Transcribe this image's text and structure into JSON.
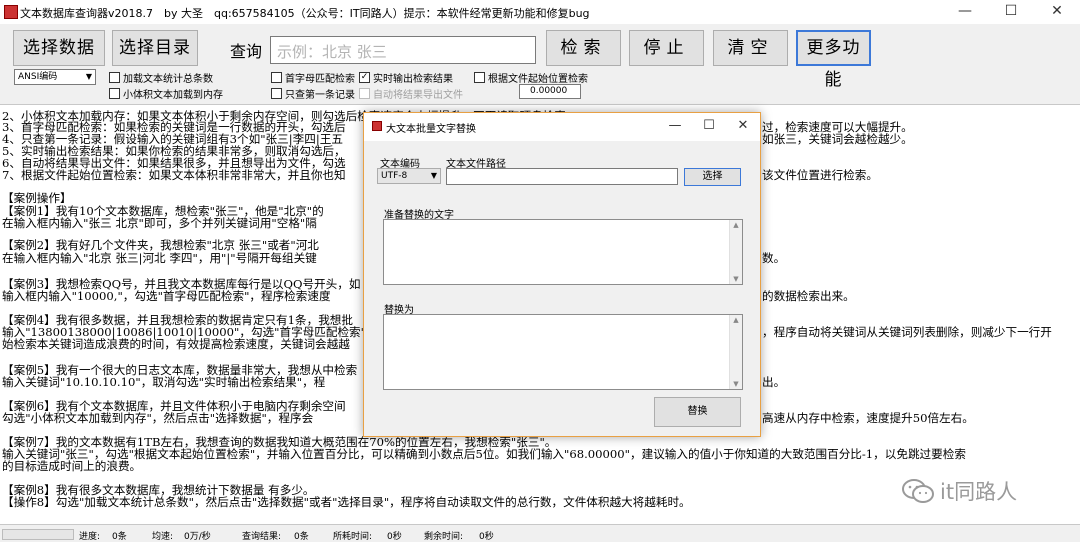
{
  "window": {
    "title": "文本数据库查询器v2018.7　by 大圣　qq:657584105（公众号：IT同路人）提示：本软件经常更新功能和修复bug",
    "minimize": "—",
    "maximize": "☐",
    "close": "✕"
  },
  "toolbar": {
    "select_data": "选择数据",
    "select_dir": "选择目录",
    "query_label": "查询",
    "search_placeholder": "示例：北京 张三",
    "search_btn": "检索",
    "stop_btn": "停止",
    "clear_btn": "清空",
    "more_btn": "更多功能"
  },
  "options": {
    "encoding": "ANSI编码",
    "load_count": "加载文本统计总条数",
    "small_load_memory": "小体积文本加载到内存",
    "prefix_match": "首字母匹配检索",
    "only_first": "只查第一条记录",
    "realtime_output": "实时输出检索结果",
    "auto_export": "自动将结果导出文件",
    "by_position": "根据文件起始位置检索",
    "position_value": "0.00000",
    "realtime_output_checked": true
  },
  "content_lines": [
    "2、小体积文本加载内存：如果文本体积小于剩余内存空间，则勾选后检索速度会大幅提升，不再读取硬盘检索。",
    "3、首字母匹配检索：如果检索的关键词是一行数据的开头，勾选后",
    "4、只查第一条记录：假设输入的关键词组有3个如\"张三|李四|王五",
    "5、实时输出检索结果：如果你检索的结果非常多，则取消勾选后，",
    "6、自动将结果导出文件：如果结果很多，并且想导出为文件，勾选",
    "7、根据文件起始位置检索：如果文本体积非常非常大，并且你也知",
    "",
    "【案例操作】",
    "【案例1】我有10个文本数据库，想检索\"张三\"，他是\"北京\"的",
    "在输入框内输入\"张三 北京\"即可，多个并列关键词用\"空格\"隔",
    "",
    "【案例2】我有好几个文件夹，我想检索\"北京 张三\"或者\"河北",
    "在输入框内输入\"北京 张三|河北 李四\"，用\"|\"号隔开每组关键",
    "",
    "【案例3】我想检索QQ号，并且我文本数据库每行是以QQ号开头，如",
    "输入框内输入\"10000,\"，勾选\"首字母匹配检索\"，程序检索速度",
    "",
    "【案例4】我有很多数据，并且我想检索的数据肯定只有1条，我想批",
    "输入\"13800138000|10086|10010|10000\"，勾选\"首字母匹配检索\"",
    "始检索本关键词造成浪费的时间，有效提高检索速度，关键词会越越",
    "",
    "【案例5】我有一个很大的日志文本库，数据量非常大，我想从中检索",
    "输入关键词\"10.10.10.10\"，取消勾选\"实时输出检索结果\"，程",
    "",
    "【案例6】我有个文本数据库，并且文件体积小于电脑内存剩余空间",
    "勾选\"小体积文本加载到内存\"，然后点击\"选择数据\"，程序会",
    "",
    "【案例7】我的文本数据有1TB左右，我想查询的数据我知道大概范围在70%的位置左右，我想检索\"张三\"。",
    "输入关键词\"张三\"，勾选\"根据文本起始位置检索\"，并输入位置百分比，可以精确到小数点后5位。如我们输入\"68.00000\"，建议输入的值小于你知道的大致范围百分比-1，以免跳过要检索",
    "的目标造成时间上的浪费。",
    "",
    "【案例8】我有很多文本数据库，我想统计下数据量 有多少。",
    "【操作8】勾选\"加载文本统计总条数\"，然后点击\"选择数据\"或者\"选择目录\"，程序将自动读取文件的总行数，文件体积越大将越耗时。"
  ],
  "right_fragments": [
    "过，检索速度可以大幅提升。",
    "如张三，关键词会越检越少。",
    "该文件位置进行检索。",
    "数。",
    "的数据检索出来。",
    "，程序自动将关键词从关键词列表删除，则减少下一行开",
    "出。",
    "高速从内存中检索，速度提升50倍左右。"
  ],
  "watermark": "it同路人",
  "status": {
    "progress_label": "进度:",
    "progress_value": "0条",
    "speed_label": "均速:",
    "speed_value": "0万/秒",
    "results_label": "查询结果:",
    "results_value": "0条",
    "elapsed_label": "所耗时间:",
    "elapsed_value": "0秒",
    "remaining_label": "剩余时间:",
    "remaining_value": "0秒"
  },
  "dialog": {
    "title": "大文本批量文字替换",
    "minimize": "—",
    "maximize": "☐",
    "close": "✕",
    "encoding_label": "文本编码",
    "path_label": "文本文件路径",
    "encoding_value": "UTF-8",
    "path_value": "",
    "browse_btn": "选择",
    "find_label": "准备替换的文字",
    "find_value": "",
    "replace_label": "替换为",
    "replace_value": "",
    "replace_btn": "替换"
  },
  "colors": {
    "accent_border": "#3c78d8",
    "dialog_border": "#e8a043",
    "placeholder": "#b4b4b4"
  }
}
